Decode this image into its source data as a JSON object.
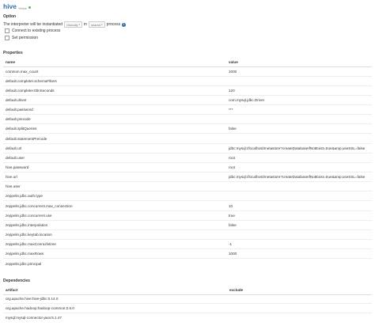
{
  "header": {
    "title": "hive",
    "subtitle": "%hive"
  },
  "option": {
    "section_title": "Option",
    "text_before": "The interpreter will be instantiated",
    "scope_select": "Globally",
    "text_in": "in",
    "mode_select": "shared",
    "text_after": "process",
    "checkboxes": [
      "Connect to existing process",
      "Set permission"
    ]
  },
  "properties": {
    "section_title": "Properties",
    "columns": [
      "name",
      "value"
    ],
    "rows": [
      [
        "common.max_count",
        "1000"
      ],
      [
        "default.completer.schemaFilters",
        ""
      ],
      [
        "default.completer.ttlInSeconds",
        "120"
      ],
      [
        "default.driver",
        "com.mysql.jdbc.Driver"
      ],
      [
        "default.password",
        "***"
      ],
      [
        "default.precode",
        ""
      ],
      [
        "default.splitQueries",
        "false"
      ],
      [
        "default.statementPrecode",
        ""
      ],
      [
        "default.url",
        "jdbc:mysql://localhost/metastore?createDatabaseIfNotExist=true&amp;useSSL=false"
      ],
      [
        "default.user",
        "root"
      ],
      [
        "hive.password",
        "root"
      ],
      [
        "hive.url",
        "jdbc:mysql://localhost/metastore?createDatabaseIfNotExist=true&amp;useSSL=false"
      ],
      [
        "hive.user",
        ""
      ],
      [
        "zeppelin.jdbc.auth.type",
        ""
      ],
      [
        "zeppelin.jdbc.concurrent.max_connection",
        "10"
      ],
      [
        "zeppelin.jdbc.concurrent.use",
        "true"
      ],
      [
        "zeppelin.jdbc.interpolation",
        "false"
      ],
      [
        "zeppelin.jdbc.keytab.location",
        ""
      ],
      [
        "zeppelin.jdbc.maxConnLifetime",
        "-1"
      ],
      [
        "zeppelin.jdbc.maxRows",
        "1000"
      ],
      [
        "zeppelin.jdbc.principal",
        ""
      ]
    ]
  },
  "dependencies": {
    "section_title": "Dependencies",
    "columns": [
      "artifact",
      "exclude"
    ],
    "rows": [
      [
        "org.apache.hive:hive-jdbc:0.14.0",
        ""
      ],
      [
        "org.apache.hadoop:hadoop-common:2.6.0",
        ""
      ],
      [
        "mysql:mysql-connector-java:5.1.47",
        ""
      ]
    ]
  },
  "colors": {
    "title": "#3071a9",
    "status": "#5cb85c"
  },
  "icons": {
    "status": "green-dot",
    "info": "info-icon"
  }
}
